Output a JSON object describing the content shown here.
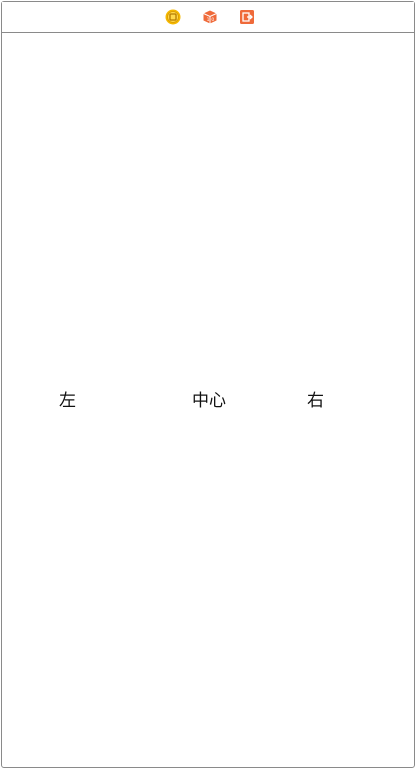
{
  "scene_dock": {
    "icons": [
      {
        "name": "view-controller-icon",
        "color": "#f5b800"
      },
      {
        "name": "first-responder-icon",
        "color": "#ef6a3a"
      },
      {
        "name": "exit-icon",
        "color": "#ef6a3a"
      }
    ]
  },
  "labels": {
    "left": "左",
    "center": "中心",
    "right": "右"
  }
}
